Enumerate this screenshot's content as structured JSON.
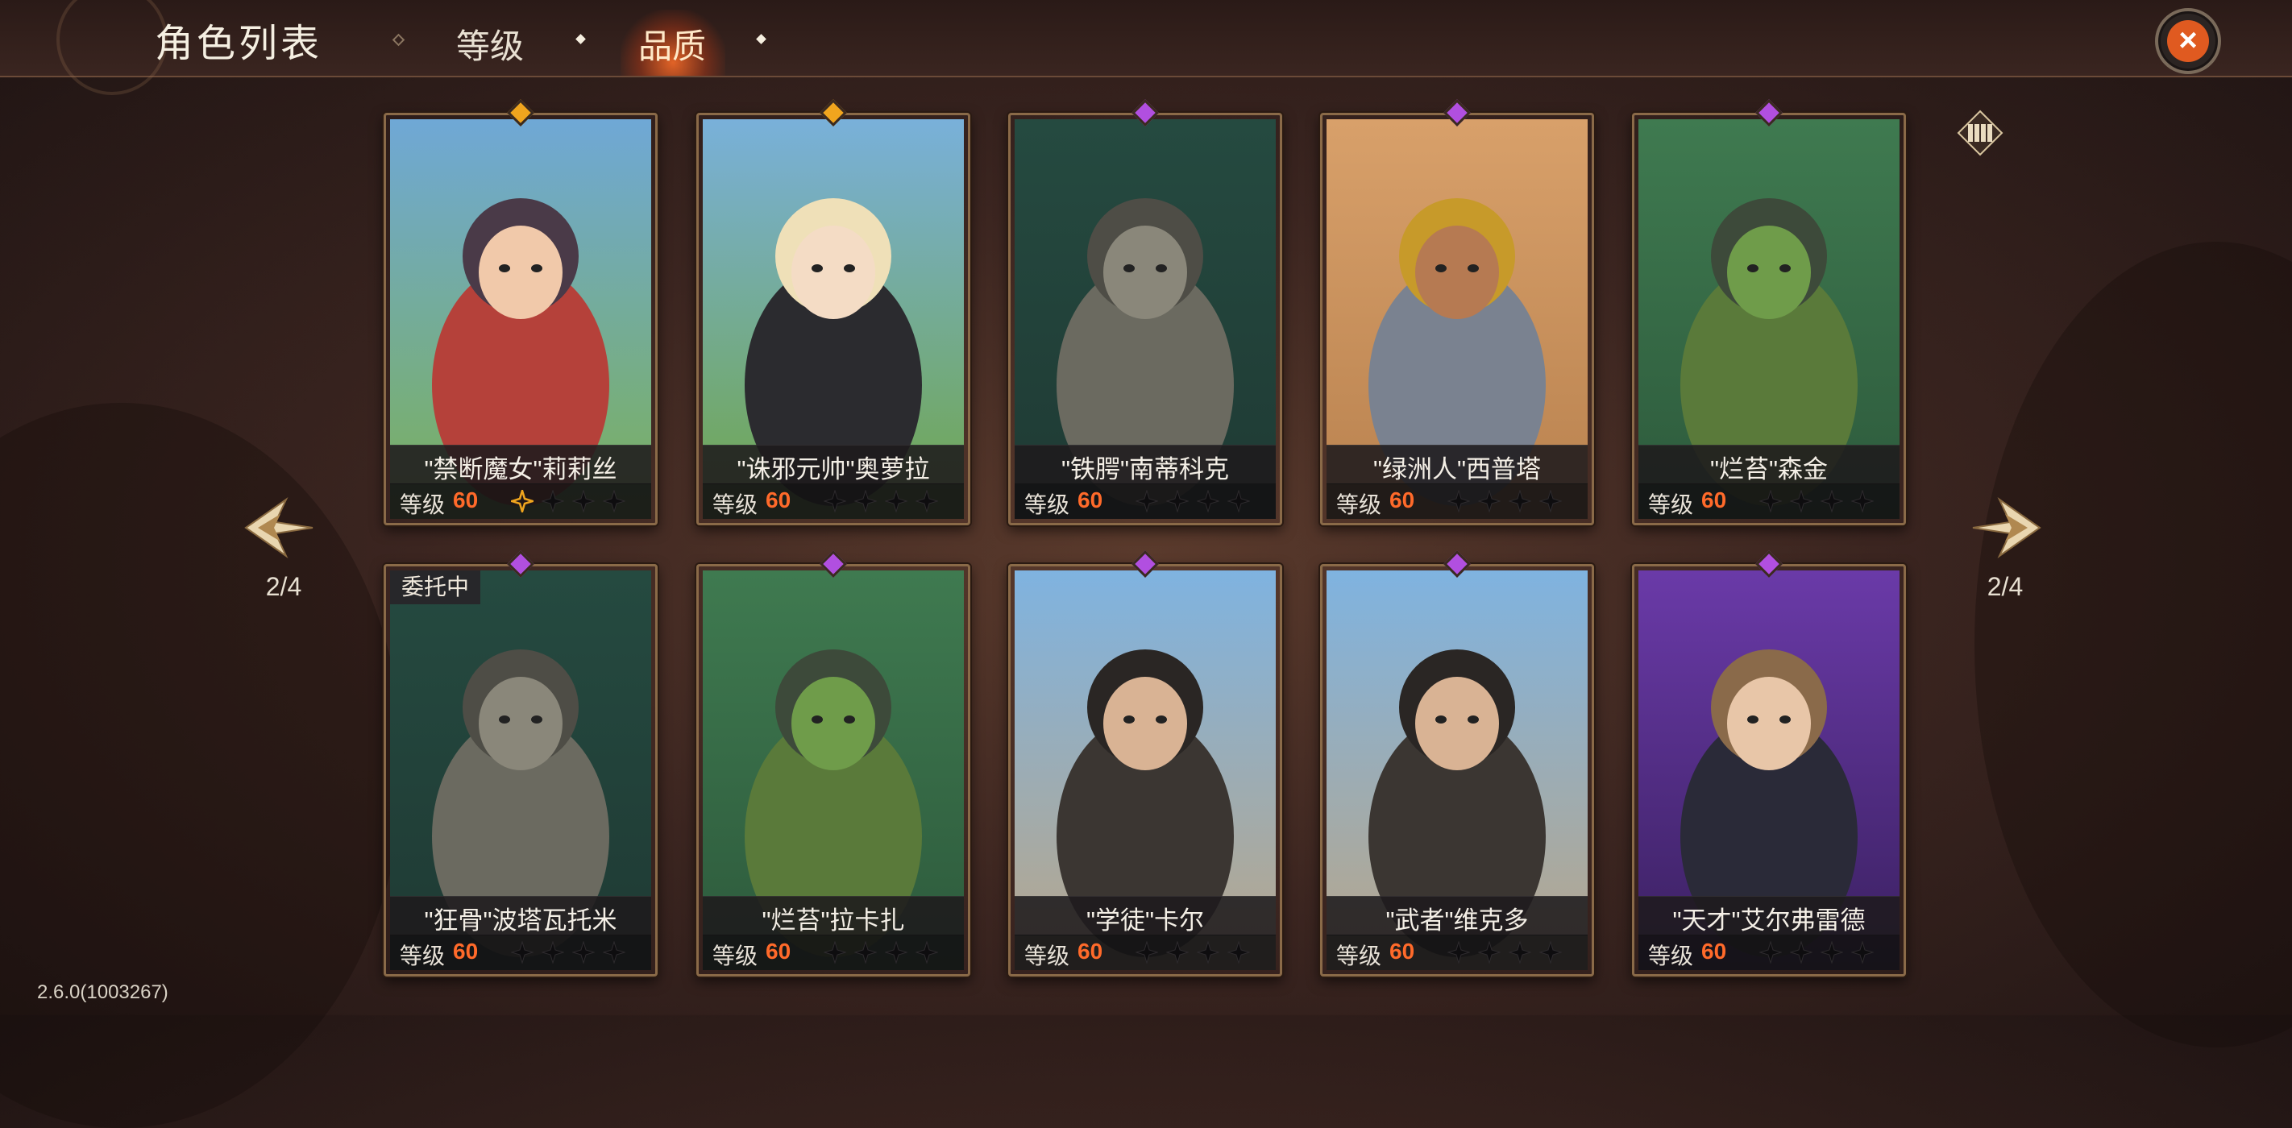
{
  "header": {
    "title": "角色列表",
    "tabs": [
      {
        "label": "等级",
        "active": false
      },
      {
        "label": "品质",
        "active": true
      }
    ]
  },
  "pagination": {
    "left_label": "2/4",
    "right_label": "2/4"
  },
  "level_label": "等级",
  "rarity_colors": {
    "legendary": "#f0a51e",
    "epic": "#b14fe0"
  },
  "cards": [
    {
      "name": "\"禁断魔女\"莉莉丝",
      "level": "60",
      "rarity": "legendary",
      "stars_filled": 1,
      "stars_total": 4,
      "badge": "",
      "art": {
        "bg": "#6fa8d6",
        "bg2": "#7ab05a",
        "figure": "#b5413a",
        "hair": "#4a3a48",
        "skin": "#f1c9aa"
      }
    },
    {
      "name": "\"诛邪元帅\"奥萝拉",
      "level": "60",
      "rarity": "legendary",
      "stars_filled": 0,
      "stars_total": 4,
      "badge": "",
      "art": {
        "bg": "#79b0da",
        "bg2": "#6fa64b",
        "figure": "#2b2b2f",
        "hair": "#efe0b8",
        "skin": "#f4dcc5"
      }
    },
    {
      "name": "\"铁腭\"南蒂科克",
      "level": "60",
      "rarity": "epic",
      "stars_filled": 0,
      "stars_total": 4,
      "badge": "",
      "art": {
        "bg": "#254a40",
        "bg2": "#1f3a34",
        "figure": "#6b6a60",
        "hair": "#4e4d46",
        "skin": "#8a877a"
      }
    },
    {
      "name": "\"绿洲人\"西普塔",
      "level": "60",
      "rarity": "epic",
      "stars_filled": 0,
      "stars_total": 4,
      "badge": "",
      "art": {
        "bg": "#d8a06a",
        "bg2": "#b9824f",
        "figure": "#7a8290",
        "hair": "#c79a2a",
        "skin": "#b67a52"
      }
    },
    {
      "name": "\"烂苔\"森金",
      "level": "60",
      "rarity": "epic",
      "stars_filled": 0,
      "stars_total": 4,
      "badge": "",
      "art": {
        "bg": "#3f7a50",
        "bg2": "#2d5a3c",
        "figure": "#5a7a3a",
        "hair": "#3d4a3a",
        "skin": "#6f9c4a"
      }
    },
    {
      "name": "\"狂骨\"波塔瓦托米",
      "level": "60",
      "rarity": "epic",
      "stars_filled": 0,
      "stars_total": 4,
      "badge": "委托中",
      "art": {
        "bg": "#254a40",
        "bg2": "#1f3a34",
        "figure": "#6b6a60",
        "hair": "#4e4d46",
        "skin": "#8a877a"
      }
    },
    {
      "name": "\"烂苔\"拉卡扎",
      "level": "60",
      "rarity": "epic",
      "stars_filled": 0,
      "stars_total": 4,
      "badge": "",
      "art": {
        "bg": "#3f7a50",
        "bg2": "#2d5a3c",
        "figure": "#5a7a3a",
        "hair": "#3d4a3a",
        "skin": "#6f9c4a"
      }
    },
    {
      "name": "\"学徒\"卡尔",
      "level": "60",
      "rarity": "epic",
      "stars_filled": 0,
      "stars_total": 4,
      "badge": "",
      "art": {
        "bg": "#7fb3e0",
        "bg2": "#b8a68a",
        "figure": "#3b3632",
        "hair": "#2a2624",
        "skin": "#d9b394"
      }
    },
    {
      "name": "\"武者\"维克多",
      "level": "60",
      "rarity": "epic",
      "stars_filled": 0,
      "stars_total": 4,
      "badge": "",
      "art": {
        "bg": "#7fb3e0",
        "bg2": "#b8a68a",
        "figure": "#3b3632",
        "hair": "#2a2624",
        "skin": "#d9b394"
      }
    },
    {
      "name": "\"天才\"艾尔弗雷德",
      "level": "60",
      "rarity": "epic",
      "stars_filled": 0,
      "stars_total": 4,
      "badge": "",
      "art": {
        "bg": "#6a3aa8",
        "bg2": "#3a2060",
        "figure": "#2a2a38",
        "hair": "#8a6a4a",
        "skin": "#e8c6a8"
      }
    }
  ],
  "version": "2.6.0(1003267)"
}
